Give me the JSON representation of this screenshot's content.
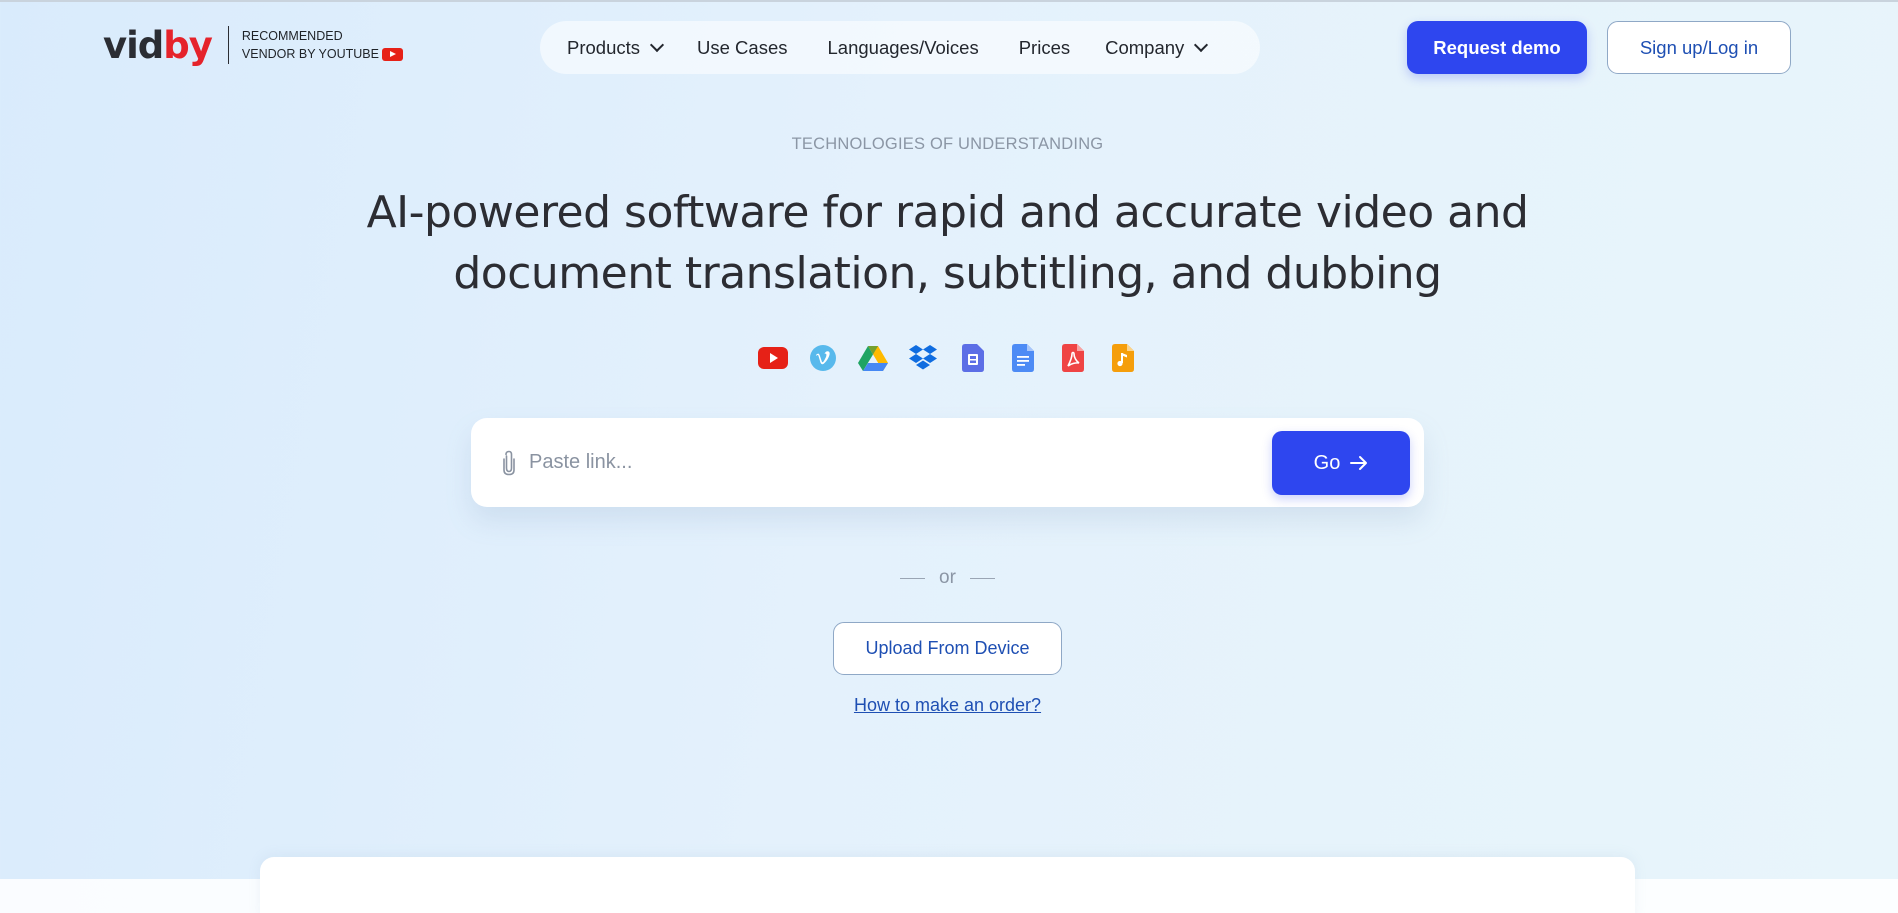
{
  "logo": {
    "part1": "vid",
    "part2": "by",
    "tagline_line1": "RECOMMENDED",
    "tagline_line2": "VENDOR BY YOUTUBE"
  },
  "nav": {
    "items": [
      {
        "label": "Products",
        "dropdown": true
      },
      {
        "label": "Use Cases",
        "dropdown": false
      },
      {
        "label": "Languages/Voices",
        "dropdown": false
      },
      {
        "label": "Prices",
        "dropdown": false
      },
      {
        "label": "Company",
        "dropdown": true
      }
    ]
  },
  "header": {
    "demo_label": "Request demo",
    "login_label": "Sign up/Log in"
  },
  "hero": {
    "eyebrow": "TECHNOLOGIES OF UNDERSTANDING",
    "headline_line1": "AI-powered software for rapid and accurate video and",
    "headline_line2": "document translation, subtitling, and dubbing"
  },
  "sources": [
    "youtube-icon",
    "vimeo-icon",
    "google-drive-icon",
    "dropbox-icon",
    "document-icon",
    "google-docs-icon",
    "pdf-icon",
    "audio-file-icon"
  ],
  "search": {
    "placeholder": "Paste link...",
    "value": "",
    "go_label": "Go"
  },
  "divider_text": "or",
  "upload_label": "Upload From Device",
  "howto_label": "How to make an order?",
  "colors": {
    "accent": "#2e46ef",
    "link": "#1e4fb3",
    "brand_red": "#e5232b"
  }
}
